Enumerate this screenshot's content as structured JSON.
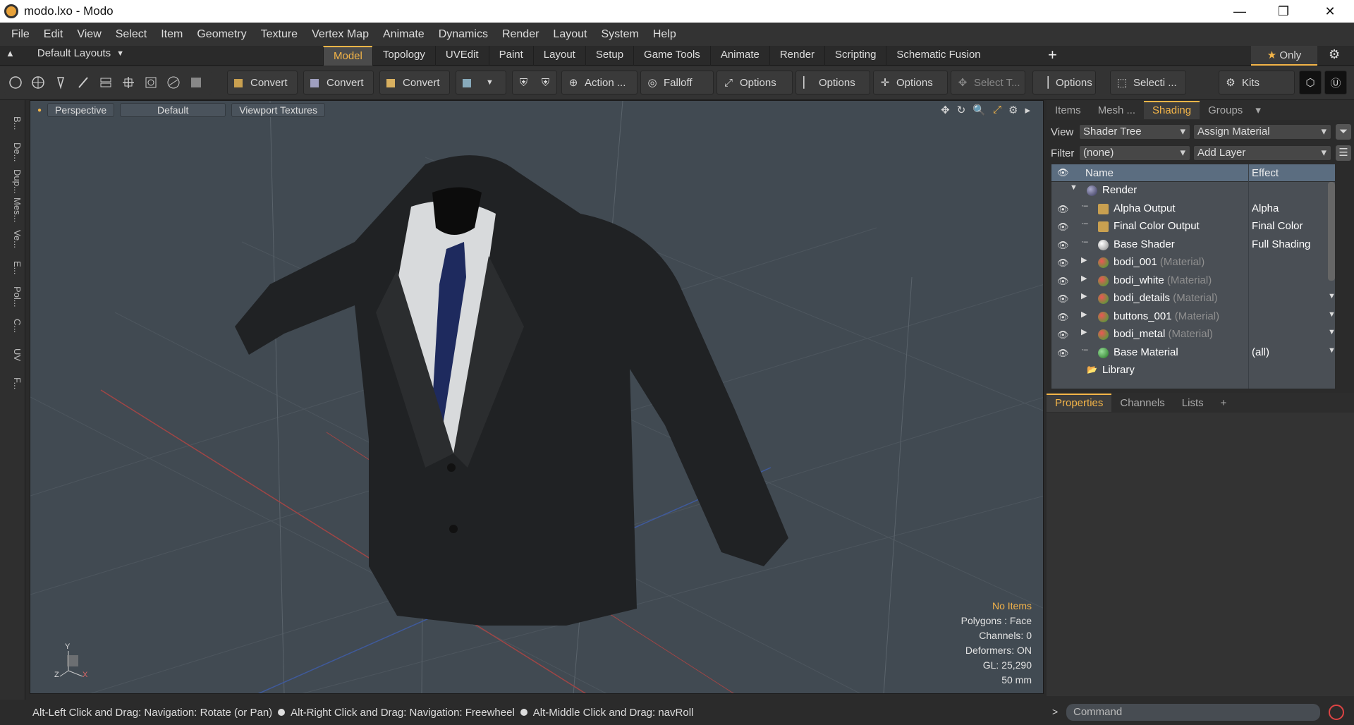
{
  "window": {
    "title": "modo.lxo - Modo",
    "minimize": "—",
    "restore": "❐",
    "close": "✕"
  },
  "menu": [
    "File",
    "Edit",
    "View",
    "Select",
    "Item",
    "Geometry",
    "Texture",
    "Vertex Map",
    "Animate",
    "Dynamics",
    "Render",
    "Layout",
    "System",
    "Help"
  ],
  "layouts": {
    "label": "Default Layouts",
    "tabs": [
      "Model",
      "Topology",
      "UVEdit",
      "Paint",
      "Layout",
      "Setup",
      "Game Tools",
      "Animate",
      "Render",
      "Scripting",
      "Schematic Fusion"
    ],
    "active": "Model",
    "only": "Only"
  },
  "toolbar": {
    "convert1": "Convert",
    "convert2": "Convert",
    "convert3": "Convert",
    "action": "Action",
    "action_more": "...",
    "falloff": "Falloff",
    "options1": "Options",
    "options2": "Options",
    "options3": "Options",
    "select_t": "Select T...",
    "options4": "Options",
    "selecti": "Selecti ...",
    "kits": "Kits"
  },
  "side_tabs": [
    "B...",
    "De...",
    "Dup...",
    "Mes...",
    "Ve...",
    "E...",
    "Pol...",
    "C...",
    "UV",
    "F..."
  ],
  "viewport": {
    "perspective": "Perspective",
    "default": "Default",
    "textures": "Viewport Textures",
    "hud": {
      "items": "No Items",
      "polygons": "Polygons : Face",
      "channels": "Channels: 0",
      "deformers": "Deformers: ON",
      "gl": "GL: 25,290",
      "mm": "50 mm"
    },
    "axis_y": "Y",
    "axis_z": "Z",
    "axis_x": "X"
  },
  "status": {
    "hint1": "Alt-Left Click and Drag: Navigation: Rotate (or Pan)",
    "hint2": "Alt-Right Click and Drag: Navigation: Freewheel",
    "hint3": "Alt-Middle Click and Drag: navRoll"
  },
  "right_panel": {
    "tabs": [
      "Items",
      "Mesh ...",
      "Shading",
      "Groups"
    ],
    "active": "Shading",
    "view_label": "View",
    "view_value": "Shader Tree",
    "assign": "Assign Material",
    "filter_label": "Filter",
    "filter_value": "(none)",
    "add_layer": "Add Layer",
    "col_name": "Name",
    "col_effect": "Effect",
    "tree": [
      {
        "name": "Render",
        "sub": "",
        "effect": "",
        "indent": 0,
        "expanded": true,
        "icon": "render",
        "eye": false
      },
      {
        "name": "Alpha Output",
        "sub": "",
        "effect": "Alpha",
        "indent": 1,
        "icon": "output",
        "eye": true
      },
      {
        "name": "Final Color Output",
        "sub": "",
        "effect": "Final Color",
        "indent": 1,
        "icon": "output",
        "eye": true
      },
      {
        "name": "Base Shader",
        "sub": "",
        "effect": "Full Shading",
        "indent": 1,
        "icon": "shader",
        "eye": true
      },
      {
        "name": "bodi_001",
        "sub": " (Material)",
        "effect": "",
        "indent": 1,
        "icon": "material",
        "collapsed": true,
        "eye": true
      },
      {
        "name": "bodi_white",
        "sub": " (Material)",
        "effect": "",
        "indent": 1,
        "icon": "material",
        "collapsed": true,
        "eye": true
      },
      {
        "name": "bodi_details",
        "sub": " (Material)",
        "effect": "",
        "indent": 1,
        "icon": "material",
        "collapsed": true,
        "eye": true
      },
      {
        "name": "buttons_001",
        "sub": " (Material)",
        "effect": "",
        "indent": 1,
        "icon": "material",
        "collapsed": true,
        "eye": true
      },
      {
        "name": "bodi_metal",
        "sub": " (Material)",
        "effect": "",
        "indent": 1,
        "icon": "material",
        "collapsed": true,
        "eye": true
      },
      {
        "name": "Base Material",
        "sub": "",
        "effect": "(all)",
        "indent": 1,
        "icon": "basemat",
        "eye": true
      },
      {
        "name": "Library",
        "sub": "",
        "effect": "",
        "indent": 0,
        "icon": "folder",
        "eye": false
      }
    ],
    "lower_tabs": [
      "Properties",
      "Channels",
      "Lists"
    ],
    "lower_active": "Properties",
    "command_placeholder": "Command"
  }
}
